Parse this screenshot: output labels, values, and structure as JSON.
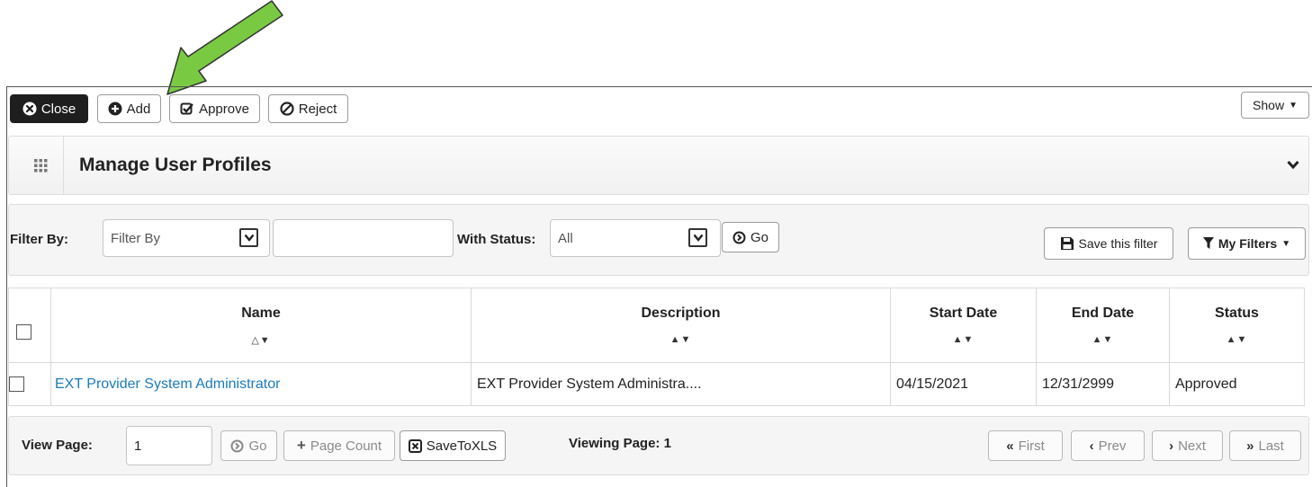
{
  "toolbar": {
    "close_label": "Close",
    "add_label": "Add",
    "approve_label": "Approve",
    "reject_label": "Reject",
    "show_label": "Show"
  },
  "panel": {
    "title": "Manage User Profiles"
  },
  "filter": {
    "filter_by_label": "Filter By:",
    "filter_by_value": "Filter By",
    "filter_text_value": "",
    "with_status_label": "With Status:",
    "status_value": "All",
    "go_label": "Go",
    "save_filter_label": "Save this filter",
    "my_filters_label": "My Filters"
  },
  "table": {
    "columns": [
      "Name",
      "Description",
      "Start Date",
      "End Date",
      "Status"
    ],
    "rows": [
      {
        "name": "EXT Provider System Administrator",
        "description": "EXT Provider System Administra....",
        "start_date": "04/15/2021",
        "end_date": "12/31/2999",
        "status": "Approved"
      }
    ]
  },
  "pager": {
    "view_page_label": "View Page:",
    "page_value": "1",
    "go_label": "Go",
    "page_count_label": "Page Count",
    "save_xls_label": "SaveToXLS",
    "viewing_page_text": "Viewing Page: 1",
    "first_label": "First",
    "prev_label": "Prev",
    "next_label": "Next",
    "last_label": "Last"
  },
  "colors": {
    "arrow_green": "#7ac943",
    "link_blue": "#1a7bbf",
    "close_bg": "#1e1e1e"
  },
  "annotation": {
    "icon": "green-arrow-icon",
    "points_to": "add-button"
  }
}
